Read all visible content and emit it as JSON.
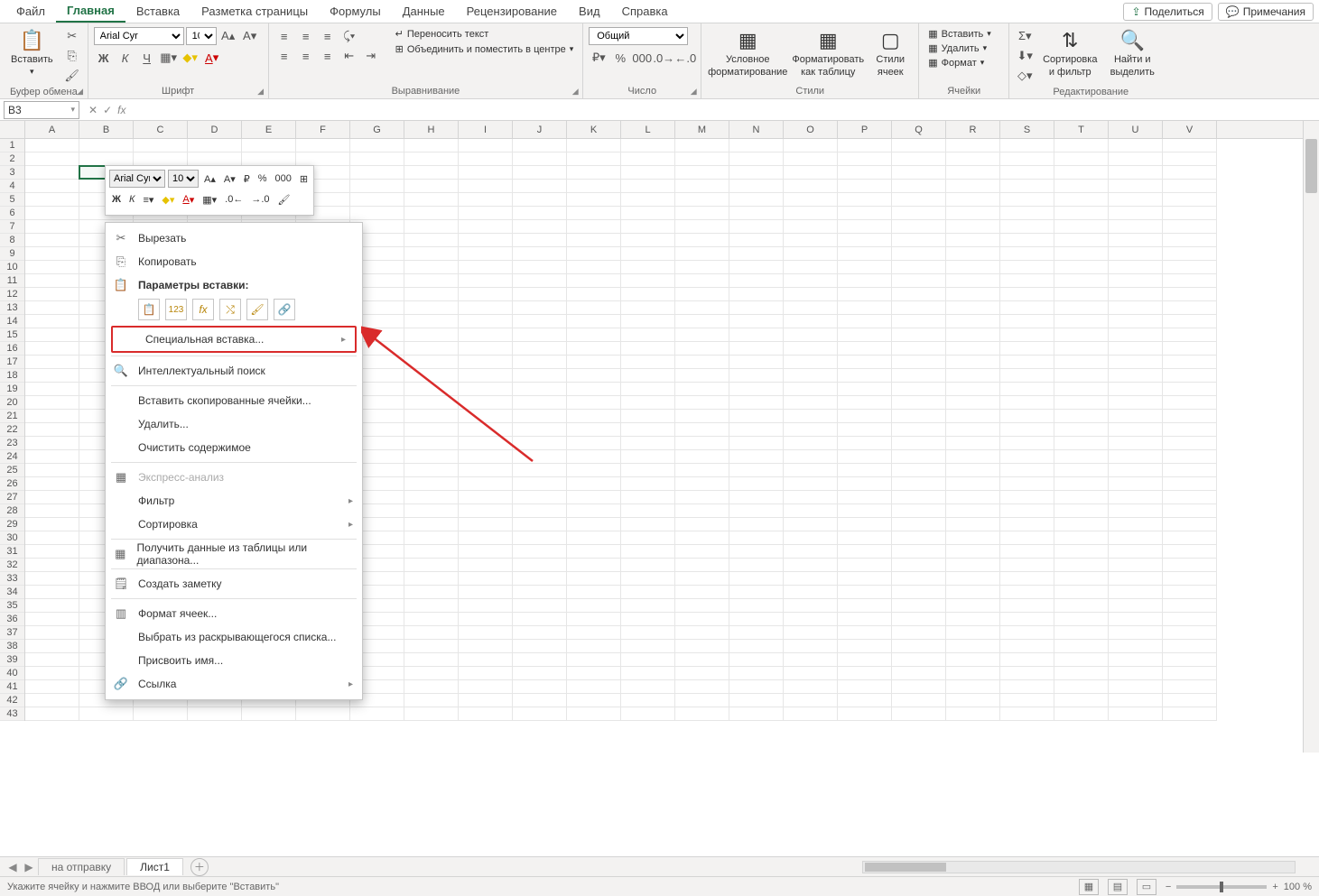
{
  "tabs": {
    "file": "Файл",
    "home": "Главная",
    "insert": "Вставка",
    "layout": "Разметка страницы",
    "formulas": "Формулы",
    "data": "Данные",
    "review": "Рецензирование",
    "view": "Вид",
    "help": "Справка",
    "share": "Поделиться",
    "comments": "Примечания"
  },
  "ribbon": {
    "clipboard": {
      "paste": "Вставить",
      "label": "Буфер обмена"
    },
    "font": {
      "name": "Arial Cyr",
      "size": "10",
      "label": "Шрифт"
    },
    "align": {
      "wrap": "Переносить текст",
      "merge": "Объединить и поместить в центре",
      "label": "Выравнивание"
    },
    "number": {
      "format": "Общий",
      "label": "Число"
    },
    "styles": {
      "cond": "Условное форматирование",
      "table": "Форматировать как таблицу",
      "cell": "Стили ячеек",
      "label": "Стили"
    },
    "cells": {
      "insert": "Вставить",
      "delete": "Удалить",
      "format": "Формат",
      "label": "Ячейки"
    },
    "editing": {
      "sort": "Сортировка и фильтр",
      "find": "Найти и выделить",
      "label": "Редактирование"
    }
  },
  "formula_bar": {
    "cell": "B3"
  },
  "grid": {
    "cols": [
      "A",
      "B",
      "C",
      "D",
      "E",
      "F",
      "G",
      "H",
      "I",
      "J",
      "K",
      "L",
      "M",
      "N",
      "O",
      "P",
      "Q",
      "R",
      "S",
      "T",
      "U",
      "V"
    ],
    "rows": 43,
    "selected": {
      "col": 1,
      "row": 2
    }
  },
  "minibar": {
    "font": "Arial Cyr",
    "size": "10"
  },
  "context_menu": {
    "cut": "Вырезать",
    "copy": "Копировать",
    "paste_hdr": "Параметры вставки:",
    "special": "Специальная вставка...",
    "smart": "Интеллектуальный поиск",
    "insertcells": "Вставить скопированные ячейки...",
    "delete": "Удалить...",
    "clear": "Очистить содержимое",
    "quick": "Экспресс-анализ",
    "filter": "Фильтр",
    "sort": "Сортировка",
    "getdata": "Получить данные из таблицы или диапазона...",
    "note": "Создать заметку",
    "formatcells": "Формат ячеек...",
    "dropdown": "Выбрать из раскрывающегося списка...",
    "name": "Присвоить имя...",
    "link": "Ссылка"
  },
  "sheets": {
    "tab1": "на отправку",
    "tab2": "Лист1"
  },
  "status": {
    "msg": "Укажите ячейку и нажмите ВВОД или выберите \"Вставить\"",
    "zoom": "100 %"
  }
}
